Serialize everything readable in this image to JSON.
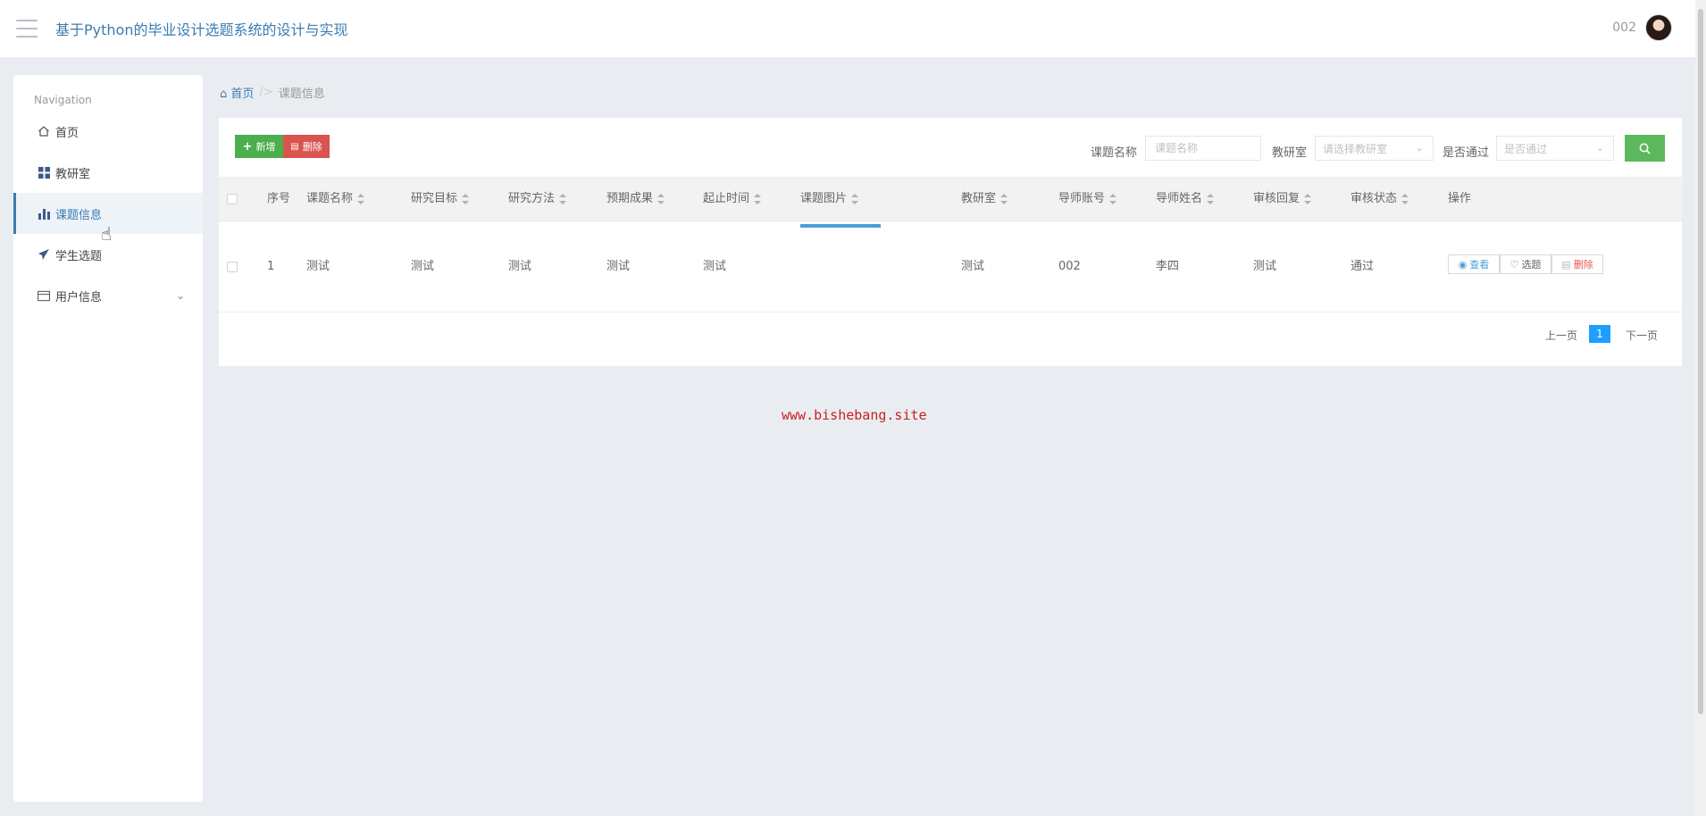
{
  "header": {
    "title": "基于Python的毕业设计选题系统的设计与实现",
    "user": "002"
  },
  "sidebar": {
    "caption": "Navigation",
    "items": [
      {
        "label": "首页",
        "icon": "home-icon"
      },
      {
        "label": "教研室",
        "icon": "grid-icon"
      },
      {
        "label": "课题信息",
        "icon": "bar-chart-icon",
        "active": true
      },
      {
        "label": "学生选题",
        "icon": "paper-plane-icon"
      },
      {
        "label": "用户信息",
        "icon": "card-icon",
        "expandable": true
      }
    ]
  },
  "breadcrumb": {
    "home": "首页",
    "separator": "/>",
    "current": "课题信息"
  },
  "toolbar": {
    "add_label": "新增",
    "delete_label": "删除"
  },
  "search": {
    "name_label": "课题名称",
    "name_placeholder": "课题名称",
    "room_label": "教研室",
    "room_placeholder": "请选择教研室",
    "pass_label": "是否通过",
    "pass_placeholder": "是否通过"
  },
  "table": {
    "columns": [
      "序号",
      "课题名称",
      "研究目标",
      "研究方法",
      "预期成果",
      "起止时间",
      "课题图片",
      "教研室",
      "导师账号",
      "导师姓名",
      "审核回复",
      "审核状态",
      "操作"
    ],
    "rows": [
      {
        "index": "1",
        "name": "测试",
        "goal": "测试",
        "method": "测试",
        "outcome": "测试",
        "period": "测试",
        "image": "",
        "room": "测试",
        "tutor_account": "002",
        "tutor_name": "李四",
        "reply": "测试",
        "status": "通过",
        "actions": {
          "view": "查看",
          "pick": "选题",
          "delete": "删除"
        }
      }
    ]
  },
  "pagination": {
    "prev": "上一页",
    "current": "1",
    "next": "下一页"
  },
  "watermark": "www.bishebang.site",
  "colors": {
    "accent": "#3a7cb0",
    "add_button": "#4cae4c",
    "delete_button": "#d9534f",
    "search_button": "#5cb85c",
    "page_current": "#1e9fff"
  }
}
